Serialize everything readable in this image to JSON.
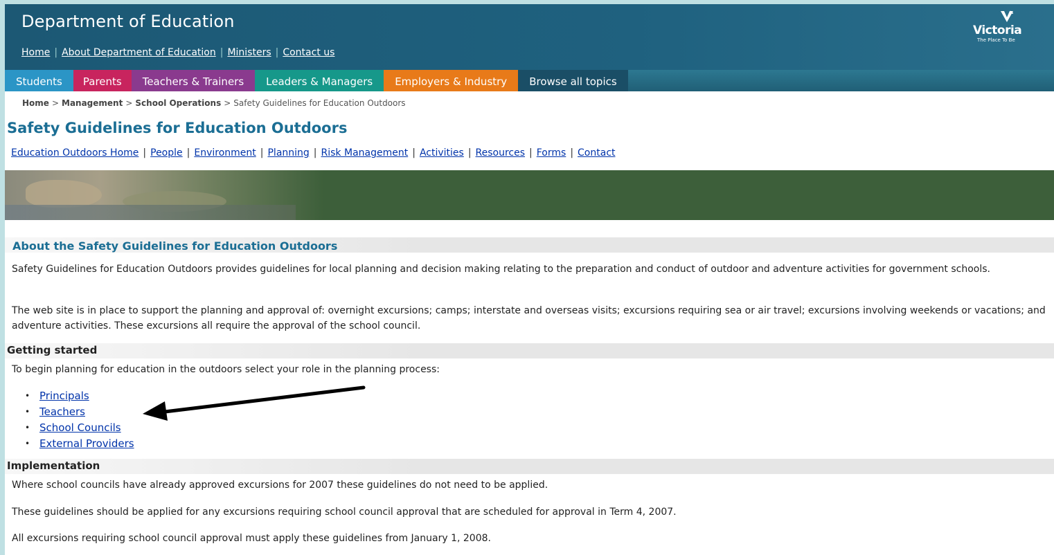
{
  "header": {
    "site_title": "Department of Education",
    "links": [
      "Home",
      "About Department of Education",
      "Ministers",
      "Contact us"
    ],
    "logo": {
      "word": "Victoria",
      "tagline": "The Place To Be"
    }
  },
  "tabs": [
    "Students",
    "Parents",
    "Teachers & Trainers",
    "Leaders & Managers",
    "Employers & Industry",
    "Browse all topics"
  ],
  "breadcrumb": {
    "items": [
      "Home",
      "Management",
      "School Operations"
    ],
    "current": "Safety Guidelines for Education Outdoors",
    "separator": ">"
  },
  "page_title": "Safety Guidelines for Education Outdoors",
  "sub_nav": [
    "Education Outdoors Home",
    "People",
    "Environment",
    "Planning",
    "Risk Management",
    "Activities",
    "Resources",
    "Forms",
    "Contact"
  ],
  "about": {
    "heading": "About the Safety Guidelines for Education Outdoors",
    "p1": "Safety Guidelines for Education Outdoors provides guidelines for local planning and decision making relating to the preparation and conduct of outdoor and adventure activities for government schools.",
    "p2": "The web site is in place to support the planning and approval of: overnight excursions; camps; interstate and overseas visits; excursions requiring sea or air travel; excursions involving weekends or vacations; and adventure activities. These excursions all require the approval of the school council."
  },
  "getting_started": {
    "heading": "Getting started",
    "intro": "To begin planning for education in the outdoors select your role in the planning process:",
    "roles": [
      "Principals",
      "Teachers",
      "School Councils",
      "External Providers"
    ]
  },
  "implementation": {
    "heading": "Implementation",
    "p1": "Where school councils have already approved excursions for 2007 these guidelines do not need to be applied.",
    "p2": "These guidelines should be applied for any excursions requiring school council approval that are scheduled for approval in Term 4, 2007.",
    "p3": "All excursions requiring school council approval must apply these guidelines from January 1, 2008."
  },
  "colors": {
    "header_bg": "#1d5b79",
    "title_blue": "#1b6e94",
    "link_blue": "#0033aa",
    "tab_students": "#2b95c6",
    "tab_parents": "#c8245e",
    "tab_teachers": "#8a3a8e",
    "tab_leaders": "#16988a",
    "tab_employers": "#e87a19",
    "tab_browse": "#1a4e66"
  }
}
